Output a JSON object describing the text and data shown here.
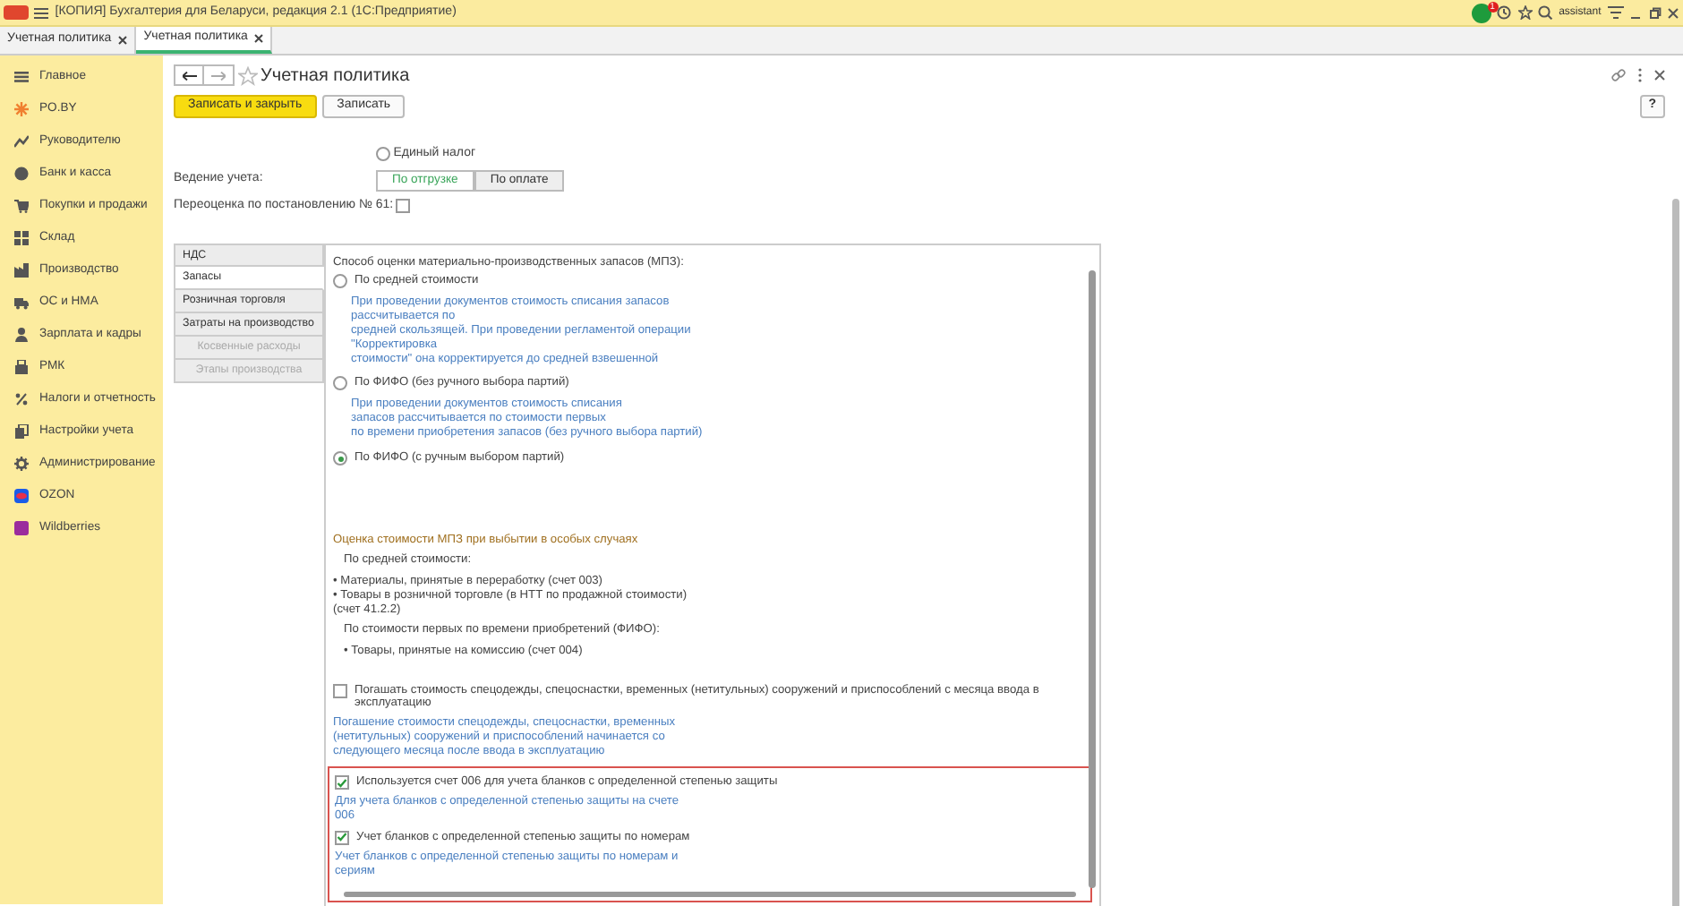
{
  "window": {
    "title": "[КОПИЯ] Бухгалтерия для Беларуси, редакция 2.1  (1С:Предприятие)",
    "notification_count": "1",
    "user": "assistant"
  },
  "tabs": [
    {
      "label": "Учетная политика",
      "selected": false
    },
    {
      "label": "Учетная политика",
      "selected": true
    }
  ],
  "sidebar": {
    "items": [
      "Главное",
      "PO.BY",
      "Руководителю",
      "Банк и касса",
      "Покупки и продажи",
      "Склад",
      "Производство",
      "ОС и НМА",
      "Зарплата и кадры",
      "РМК",
      "Налоги и отчетность",
      "Настройки учета",
      "Администрирование",
      "OZON",
      "Wildberries"
    ]
  },
  "form": {
    "title": "Учетная политика",
    "buttons": [
      {
        "label": "Записать и закрыть",
        "kind": "primary"
      },
      {
        "label": "Записать",
        "kind": "default"
      }
    ],
    "help": "?",
    "tax_option": {
      "label": "Единый налог",
      "selected": false
    },
    "accounting": {
      "label": "Ведение учета:",
      "options": [
        {
          "label": "По отгрузке",
          "selected": true
        },
        {
          "label": "По оплате",
          "selected": false
        }
      ]
    },
    "revaluation": {
      "label": "Переоценка по постановлению № 61:",
      "checked": false
    },
    "sections": [
      {
        "label": "НДС",
        "selected": false,
        "disabled": false
      },
      {
        "label": "Запасы",
        "selected": true,
        "disabled": false
      },
      {
        "label": "Розничная торговля",
        "selected": false,
        "disabled": false
      },
      {
        "label": "Затраты на производство",
        "selected": false,
        "disabled": false
      },
      {
        "label": "Косвенные расходы",
        "selected": false,
        "disabled": true
      },
      {
        "label": "Этапы производства",
        "selected": false,
        "disabled": true
      }
    ],
    "panel": [
      {
        "kind": "heading",
        "text": "Способ оценки материально-производственных запасов (МПЗ):"
      },
      {
        "kind": "radio",
        "label": "По средней стоимости",
        "selected": false
      },
      {
        "kind": "note",
        "text": "При проведении документов стоимость списания запасов\nрассчитывается по\nсредней скользящей. При проведении регламентой операции\n\"Корректировка\nстоимости\" она корректируется до средней взвешенной"
      },
      {
        "kind": "radio",
        "label": "По ФИФО (без ручного выбора партий)",
        "selected": false
      },
      {
        "kind": "note",
        "text": "При проведении документов стоимость списания\nзапасов рассчитывается по стоимости первых\nпо времени приобретения запасов (без ручного выбора партий)"
      },
      {
        "kind": "radio",
        "label": "По ФИФО (с ручным выбором партий)",
        "selected": true
      },
      {
        "kind": "section",
        "text": "Оценка стоимости МПЗ при выбытии в  особых случаях"
      },
      {
        "kind": "subheading",
        "text": "По средней стоимости:"
      },
      {
        "kind": "text",
        "text": "• Материалы, принятые в переработку (счет 003)\n • Товары в розничной торговле (в НТТ по продажной стоимости)\n(счет 41.2.2)"
      },
      {
        "kind": "subheading",
        "text": "По стоимости первых по времени приобретений (ФИФО):"
      },
      {
        "kind": "list",
        "text": "• Товары, принятые на комиссию (счет 004)"
      },
      {
        "kind": "checkbox",
        "label": "Погашать стоимость спецодежды, спецоснастки,  временных (нетитульных) сооружений и приспособлений с месяца ввода в эксплуатацию",
        "checked": false
      },
      {
        "kind": "hint",
        "text": "Погашение стоимости спецодежды, спецоснастки, временных\n(нетитульных) сооружений и приспособлений начинается со\nследующего месяца после ввода в эксплуатацию"
      },
      {
        "kind": "highlight",
        "items": [
          {
            "kind": "checkbox",
            "label": "Используется счет 006 для учета бланков с определенной степенью защиты",
            "checked": true
          },
          {
            "kind": "hint",
            "text": "Для учета бланков с определенной степенью защиты на счете\n006"
          },
          {
            "kind": "checkbox",
            "label": "Учет бланков с определенной степенью защиты по номерам",
            "checked": true
          },
          {
            "kind": "hint",
            "text": "Учет бланков с определенной степенью защиты по номерам и\nсериям"
          }
        ]
      }
    ]
  }
}
